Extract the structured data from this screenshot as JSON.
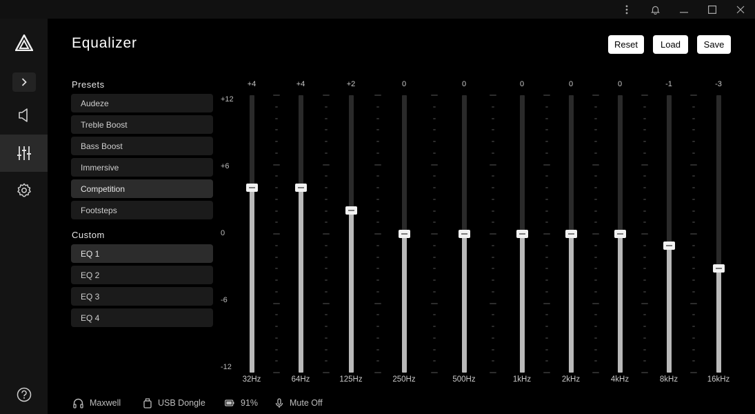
{
  "window": {
    "icons": [
      "more-vertical-icon",
      "bell-icon",
      "minimize-icon",
      "maximize-icon",
      "close-icon"
    ]
  },
  "sidebar": {
    "items": [
      {
        "name": "logo",
        "icon": "logo-icon"
      },
      {
        "name": "expand",
        "icon": "chevron-right-icon"
      },
      {
        "name": "audio",
        "icon": "speaker-icon"
      },
      {
        "name": "equalizer",
        "icon": "sliders-icon",
        "active": true
      },
      {
        "name": "settings",
        "icon": "gear-icon"
      },
      {
        "name": "help",
        "icon": "help-icon"
      }
    ]
  },
  "header": {
    "title": "Equalizer",
    "reset_label": "Reset",
    "load_label": "Load",
    "save_label": "Save"
  },
  "presets": {
    "label": "Presets",
    "items": [
      "Audeze",
      "Treble Boost",
      "Bass Boost",
      "Immersive",
      "Competition",
      "Footsteps"
    ],
    "selected": "Competition"
  },
  "custom": {
    "label": "Custom",
    "items": [
      "EQ 1",
      "EQ 2",
      "EQ 3",
      "EQ 4"
    ],
    "selected": "EQ 1"
  },
  "eq": {
    "min": -12,
    "max": 12,
    "scale": [
      "+12",
      "+6",
      "0",
      "-6",
      "-12"
    ],
    "bands": [
      {
        "freq": "32Hz",
        "value": 4,
        "label": "+4"
      },
      {
        "freq": "64Hz",
        "value": 4,
        "label": "+4"
      },
      {
        "freq": "125Hz",
        "value": 2,
        "label": "+2"
      },
      {
        "freq": "250Hz",
        "value": 0,
        "label": "0"
      },
      {
        "freq": "500Hz",
        "value": 0,
        "label": "0"
      },
      {
        "freq": "1kHz",
        "value": 0,
        "label": "0"
      },
      {
        "freq": "2kHz",
        "value": 0,
        "label": "0"
      },
      {
        "freq": "4kHz",
        "value": 0,
        "label": "0"
      },
      {
        "freq": "8kHz",
        "value": -1,
        "label": "-1"
      },
      {
        "freq": "16kHz",
        "value": -3,
        "label": "-3"
      }
    ]
  },
  "status": {
    "device": "Maxwell",
    "connection": "USB Dongle",
    "battery": "91%",
    "mic": "Mute Off"
  }
}
